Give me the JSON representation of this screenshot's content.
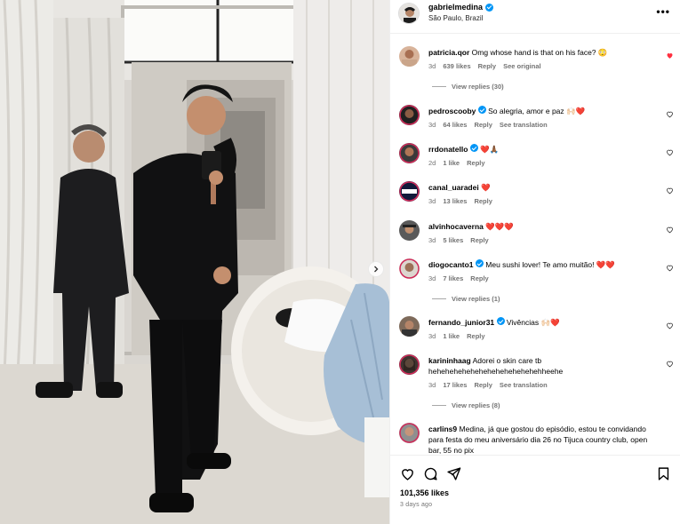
{
  "post": {
    "username": "gabrielmedina",
    "location": "São Paulo, Brazil",
    "more_label": "•••",
    "likes": "101,356 likes",
    "time_ago": "3 days ago"
  },
  "comments": [
    {
      "user": "patricia.qor",
      "text": "Omg whose hand is that on his face? 😳",
      "time": "3d",
      "likes": "639 likes",
      "reply": "Reply",
      "extra": "See original",
      "view_replies": "View replies (30)",
      "liked": true,
      "verified": false
    },
    {
      "user": "pedroscooby",
      "text": "So alegria, amor e paz 🙌🏻❤️",
      "time": "3d",
      "likes": "64 likes",
      "reply": "Reply",
      "extra": "See translation",
      "verified": true
    },
    {
      "user": "rrdonatello",
      "text": "❤️🙏🏾",
      "time": "2d",
      "likes": "1 like",
      "reply": "Reply",
      "verified": true
    },
    {
      "user": "canal_uaradei",
      "text": "❤️",
      "time": "3d",
      "likes": "13 likes",
      "reply": "Reply",
      "verified": false
    },
    {
      "user": "alvinhocaverna",
      "text": "❤️❤️❤️",
      "time": "3d",
      "likes": "5 likes",
      "reply": "Reply",
      "verified": false
    },
    {
      "user": "diogocanto1",
      "text": "Meu sushi lover! Te amo muitão! ❤️❤️",
      "time": "3d",
      "likes": "7 likes",
      "reply": "Reply",
      "view_replies": "View replies (1)",
      "verified": true
    },
    {
      "user": "fernando_junior31",
      "text": "Vivências 🙌🏻❤️",
      "time": "3d",
      "likes": "1 like",
      "reply": "Reply",
      "verified": true
    },
    {
      "user": "karininhaag",
      "text": "Adorei o skin care tb hehehehehehehehehehehehehehheehe",
      "time": "3d",
      "likes": "17 likes",
      "reply": "Reply",
      "extra": "See translation",
      "view_replies": "View replies (8)",
      "verified": false
    },
    {
      "user": "carlins9",
      "text": "Medina, já que gostou do episódio, estou te convidando para festa do meu aniversário dia 26 no Tijuca country club, open bar, 55 no pix",
      "verified": false
    }
  ],
  "colors": {
    "accent": "#0095f6",
    "liked_heart": "#ff3040",
    "muted": "#737373"
  },
  "icons": [
    "heart-icon",
    "comment-icon",
    "share-icon",
    "bookmark-icon",
    "verified-badge-icon",
    "chevron-right-icon",
    "more-icon"
  ]
}
